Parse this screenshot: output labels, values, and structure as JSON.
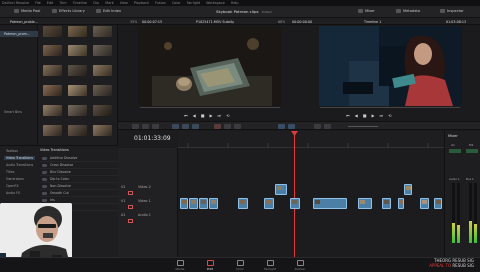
{
  "menubar": {
    "items": [
      "DaVinci Resolve",
      "File",
      "Edit",
      "Trim",
      "Timeline",
      "Clip",
      "Mark",
      "View",
      "Playback",
      "Fusion",
      "Color",
      "Fairlight",
      "Workspace",
      "Help"
    ]
  },
  "toolbar": {
    "media_pool": "Media Pool",
    "effects_library": "Effects Library",
    "edit_index": "Edit Index",
    "project_title": "Skybook Patreon clips",
    "edited": "Edited",
    "mixer": "Mixer",
    "metadata": "Metadata",
    "inspector": "Inspector"
  },
  "viewer_bar": {
    "bin_name": "Patreon_proble...",
    "zoom": "35%",
    "source_tc": "00:00:07:15",
    "clip_name": "P1025471.MOV Subclip",
    "timeline_zoom": "68%",
    "timeline_tc_left": "00:00:00:00",
    "timeline_name": "Timeline 1",
    "timeline_tc_right": "01:03:08:13"
  },
  "bins": [
    {
      "label": "Patreon_prom...",
      "selected": true
    },
    {
      "label": "Smart Bins",
      "selected": false
    }
  ],
  "timeline": {
    "timecode": "01:01:33:09",
    "tracks": [
      {
        "id": "V2",
        "label": "Video 2"
      },
      {
        "id": "V1",
        "label": "Video 1"
      },
      {
        "id": "A1",
        "label": "Audio 1"
      }
    ]
  },
  "effects": {
    "sidebar": [
      "Toolbox",
      "Video Transitions",
      "Audio Transitions",
      "Titles",
      "Generators",
      "OpenFX",
      "Audio FX"
    ],
    "header": "Video Transitions",
    "items": [
      "Additive Dissolve",
      "Cross Dissolve",
      "Blur Dissolve",
      "Dip to Color",
      "Non-Dissolve",
      "Smooth Cut",
      "Iris",
      "Clock Wipe"
    ]
  },
  "mixer": {
    "title": "Mixer",
    "channels": [
      "A1",
      "M1"
    ],
    "bus_label": "Audio 1",
    "bus_label2": "Bus 1"
  },
  "pages": [
    "Media",
    "Edit",
    "Color",
    "Fairlight",
    "Deliver"
  ],
  "active_page": "Edit",
  "watermark": {
    "line1": "THEORG RESUB SIG",
    "line2_red": "APPEAL TO",
    "line2": "RESUB SIG"
  },
  "colors": {
    "accent_red": "#e23b3b",
    "clip_blue": "#4c7fa5",
    "selection_blue": "#2e3a48"
  }
}
